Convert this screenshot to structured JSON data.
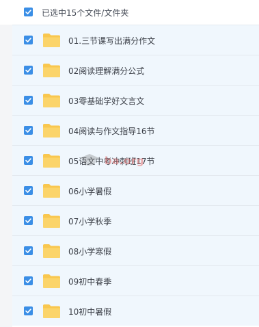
{
  "header": {
    "selection_label": "已选中15个文件/文件夹",
    "checkbox_checked": true
  },
  "folders": [
    {
      "name": "01.三节课写出满分作文",
      "checked": true
    },
    {
      "name": "02阅读理解满分公式",
      "checked": true
    },
    {
      "name": "03零基础学好文言文",
      "checked": true
    },
    {
      "name": "04阅读与作文指导16节",
      "checked": true
    },
    {
      "name": "05语文中考冲刺班17节",
      "checked": true
    },
    {
      "name": "06小学暑假",
      "checked": true
    },
    {
      "name": "07小学秋季",
      "checked": true
    },
    {
      "name": "08小学寒假",
      "checked": true
    },
    {
      "name": "09初中春季",
      "checked": true
    },
    {
      "name": "10初中暑假",
      "checked": true
    }
  ],
  "watermark": {
    "text": "ba.org"
  },
  "colors": {
    "checkbox": "#3a8ee6",
    "folder": "#f9c74f",
    "row_bg": "#f0f7fd",
    "row_border": "#e3e8ee"
  },
  "icons": {
    "checkbox": "checkbox-checked-icon",
    "folder": "folder-icon"
  }
}
